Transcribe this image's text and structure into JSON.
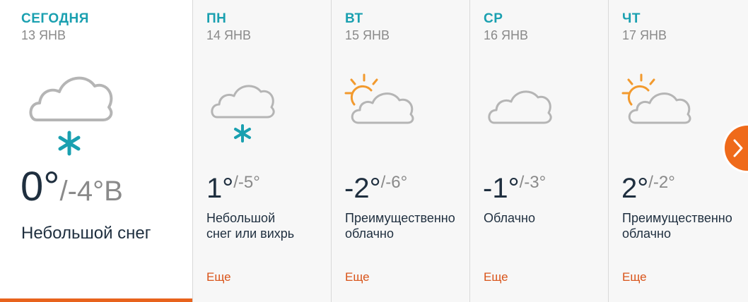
{
  "colors": {
    "accent": "#1aa0b0",
    "more_link": "#d9541a",
    "today_underline": "#e8631d",
    "nav_button": "#ef6a1a"
  },
  "days": [
    {
      "name": "СЕГОДНЯ",
      "date": "13 ЯНВ",
      "icon": "cloud-snow-icon",
      "hi": "0°",
      "lo": "/-4°В",
      "condition": [
        "Небольшой снег"
      ],
      "selected": true
    },
    {
      "name": "ПН",
      "date": "14 ЯНВ",
      "icon": "cloud-snow-icon",
      "hi": "1°",
      "lo": "/-5°",
      "condition": [
        "Небольшой",
        "снег или вихрь"
      ],
      "more": "Еще"
    },
    {
      "name": "ВТ",
      "date": "15 ЯНВ",
      "icon": "partly-cloudy-icon",
      "hi": "-2°",
      "lo": "/-6°",
      "condition": [
        "Преимущественно",
        "облачно"
      ],
      "more": "Еще"
    },
    {
      "name": "СР",
      "date": "16 ЯНВ",
      "icon": "cloud-icon",
      "hi": "-1°",
      "lo": "/-3°",
      "condition": [
        "Облачно"
      ],
      "more": "Еще"
    },
    {
      "name": "ЧТ",
      "date": "17 ЯНВ",
      "icon": "partly-cloudy-icon",
      "hi": "2°",
      "lo": "/-2°",
      "condition": [
        "Преимущественно",
        "облачно"
      ],
      "more": "Еще"
    }
  ],
  "nav": {
    "next_icon": "chevron-right-icon"
  }
}
